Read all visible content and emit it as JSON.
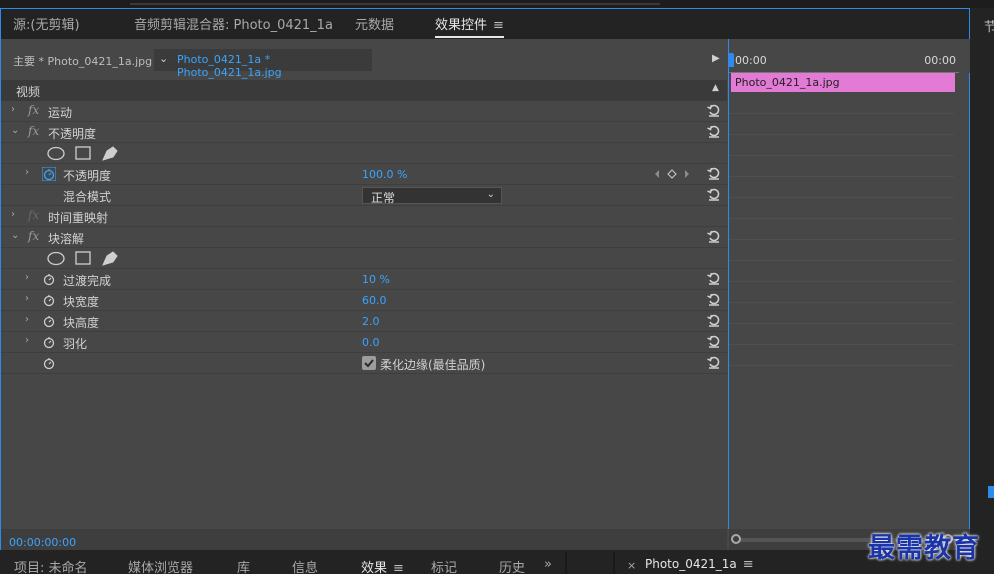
{
  "tabs": [
    {
      "label": "源:(无剪辑)"
    },
    {
      "label": "音频剪辑混合器: Photo_0421_1a"
    },
    {
      "label": "元数据"
    },
    {
      "label": "效果控件"
    }
  ],
  "source": {
    "main_label": "主要 * Photo_0421_1a.jpg",
    "clip_label": "Photo_0421_1a * Photo_0421_1a.jpg"
  },
  "rows": {
    "section": "视频",
    "motion": "运动",
    "opacity_group": "不透明度",
    "opacity_param": "不透明度",
    "opacity_value": "100.0 %",
    "blend_mode_label": "混合模式",
    "blend_mode_value": "正常",
    "time_remap": "时间重映射",
    "block_dissolve": "块溶解",
    "transition_completion": "过渡完成",
    "transition_completion_value": "10 %",
    "block_width": "块宽度",
    "block_width_value": "60.0",
    "block_height": "块高度",
    "block_height_value": "2.0",
    "feather": "羽化",
    "feather_value": "0.0",
    "soften_edges": "柔化边缘(最佳品质)"
  },
  "timecode": "00:00:00:00",
  "timeline": {
    "start": "00:00",
    "end": "00:00",
    "clip_name": "Photo_0421_1a.jpg"
  },
  "bottom_tabs": [
    {
      "label": "项目: 未命名"
    },
    {
      "label": "媒体浏览器"
    },
    {
      "label": "库"
    },
    {
      "label": "信息"
    },
    {
      "label": "效果"
    },
    {
      "label": "标记"
    },
    {
      "label": "历史"
    },
    {
      "label": "Photo_0421_1a"
    }
  ],
  "right_edge_char": "节",
  "watermark": "最需教育",
  "colors": {
    "accent": "#2d8ceb",
    "value_blue": "#3aa4ff",
    "clip_pink": "#e37ad5",
    "watermark": "#1b35a8"
  }
}
